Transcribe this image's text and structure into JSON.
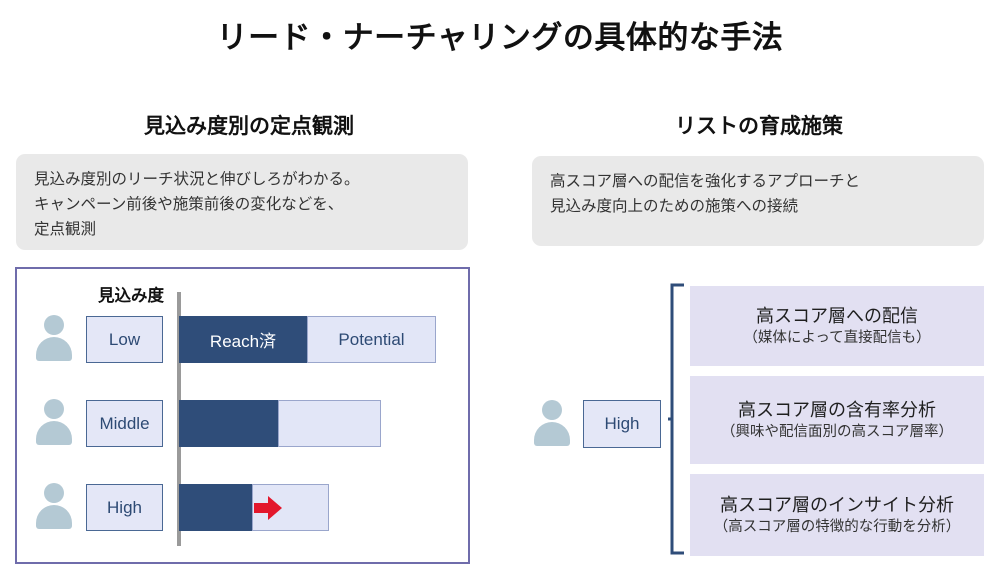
{
  "title": "リード・ナーチャリングの具体的な手法",
  "left": {
    "heading": "見込み度別の定点観測",
    "description_lines": [
      "見込み度別のリーチ状況と伸びしろがわかる。",
      "キャンペーン前後や施策前後の変化などを、",
      "定点観測"
    ],
    "chart": {
      "axis_caption": "見込み度",
      "legend_reached": "Reach済",
      "legend_potential": "Potential"
    }
  },
  "right": {
    "heading": "リストの育成施策",
    "description_lines": [
      "高スコア層への配信を強化するアプローチと",
      "見込み度向上のための施策への接続"
    ],
    "segment_label": "High",
    "cards": [
      {
        "title": "高スコア層への配信",
        "subtitle": "（媒体によって直接配信も）"
      },
      {
        "title": "高スコア層の含有率分析",
        "subtitle": "（興味や配信面別の高スコア層率）"
      },
      {
        "title": "高スコア層のインサイト分析",
        "subtitle": "（高スコア層の特徴的な行動を分析）"
      }
    ]
  },
  "chart_data": {
    "type": "bar",
    "orientation": "horizontal",
    "stacked": true,
    "title": "見込み度別の定点観測",
    "xlabel": "",
    "ylabel": "見込み度",
    "categories": [
      "Low",
      "Middle",
      "High"
    ],
    "series": [
      {
        "name": "Reach済",
        "values": [
          128,
          99,
          73
        ]
      },
      {
        "name": "Potential",
        "values": [
          129,
          103,
          77
        ]
      }
    ],
    "annotations": [
      {
        "category": "High",
        "type": "arrow",
        "direction": "right",
        "color": "#e3172c",
        "meaning": "伸びしろ"
      }
    ],
    "colors": {
      "reached": "#2f4d79",
      "potential": "#e2e6f7",
      "arrow": "#e3172c",
      "axis": "#9a9a9a",
      "panel_border": "#6f6cab"
    },
    "grid": false,
    "legend": "inline-first-bar"
  }
}
